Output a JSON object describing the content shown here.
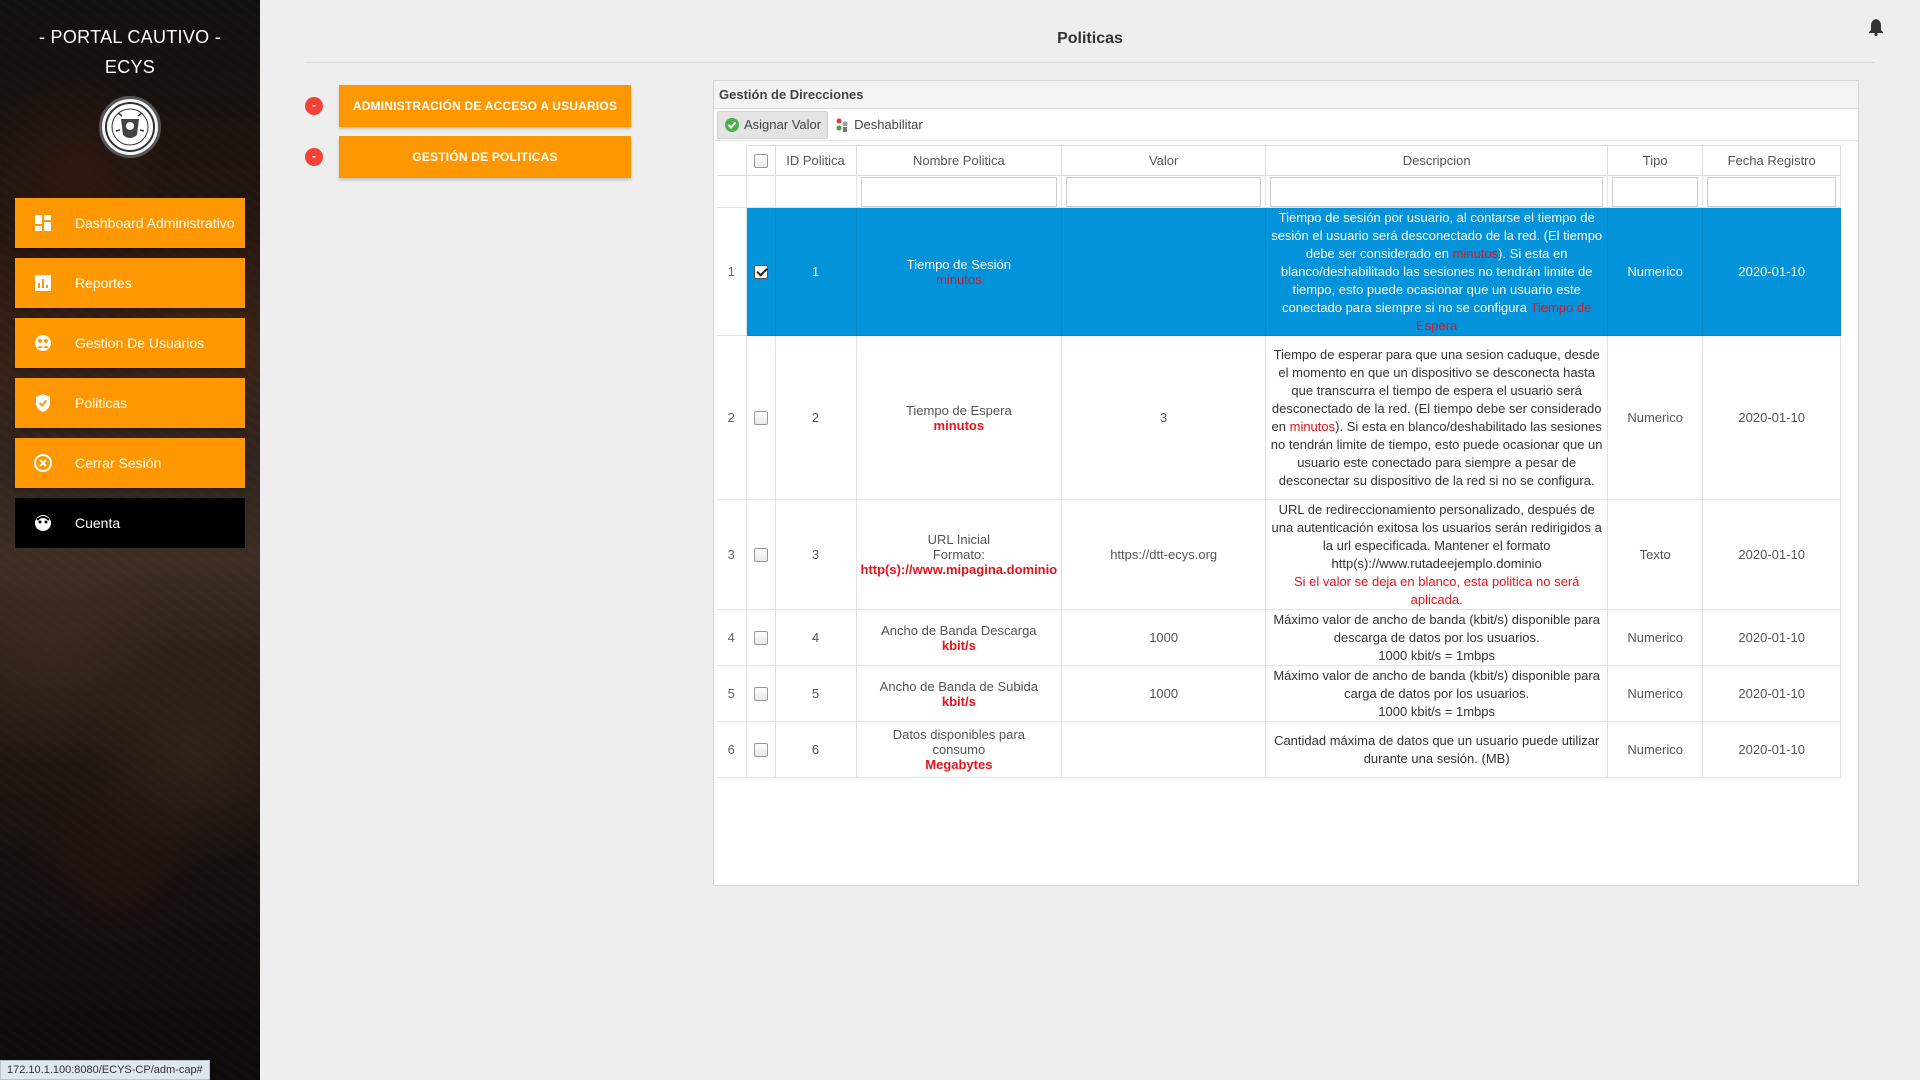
{
  "brand": {
    "line1": "- PORTAL CAUTIVO -",
    "line2": "ECYS"
  },
  "sidebar": {
    "items": [
      {
        "label": "Dashboard Administrativo",
        "icon": "dashboard-icon"
      },
      {
        "label": "Reportes",
        "icon": "bar-chart-icon"
      },
      {
        "label": "Gestion De Usuarios",
        "icon": "users-icon"
      },
      {
        "label": "Politicas",
        "icon": "shield-check-icon"
      },
      {
        "label": "Cerrar Sesión",
        "icon": "close-circle-icon"
      },
      {
        "label": "Cuenta",
        "icon": "account-icon"
      }
    ]
  },
  "header": {
    "title": "Politicas"
  },
  "actions": [
    {
      "dot": "-",
      "label": "Administración de acceso a usuarios"
    },
    {
      "dot": "-",
      "label": "Gestión de Politicas"
    }
  ],
  "panel": {
    "title": "Gestión de Direcciones",
    "toolbar": {
      "assign": "Asignar Valor",
      "disable": "Deshabilitar"
    },
    "columns": [
      "ID Politica",
      "Nombre Politica",
      "Valor",
      "Descripcion",
      "Tipo",
      "Fecha Registro"
    ],
    "rows": [
      {
        "num": "1",
        "checked": true,
        "selected": true,
        "id": "1",
        "name": "Tiempo de Sesión",
        "name2": "",
        "unit": "minutos",
        "valor": "",
        "desc_a": "Tiempo de sesión por usuario, al contarse el tiempo de sesión el usuario será desconectado de la red. (El tiempo debe ser considerado en ",
        "desc_red1": "minutos",
        "desc_b": "). Si esta en blanco/deshabilitado las sesiones no tendrán limite de tiempo, esto puede ocasionar que un usuario este conectado para siempre si no se configura ",
        "desc_red2": "Tiempo de Espera",
        "desc_c": "",
        "tipo": "Numerico",
        "fecha": "2020-01-10"
      },
      {
        "num": "2",
        "checked": false,
        "selected": false,
        "id": "2",
        "name": "Tiempo de Espera",
        "name2": "",
        "unit": "minutos",
        "valor": "3",
        "desc_a": "Tiempo de esperar para que una sesion caduque, desde el momento en que un dispositivo se desconecta hasta que transcurra el tiempo de espera el usuario será desconectado de la red. (El tiempo debe ser considerado en ",
        "desc_red1": "minutos",
        "desc_b": "). Si esta en blanco/deshabilitado las sesiones no tendrán limite de tiempo, esto puede ocasionar que un usuario este conectado para siempre a pesar de desconectar su dispositivo de la red si no se configura.",
        "desc_red2": "",
        "desc_c": "",
        "tipo": "Numerico",
        "fecha": "2020-01-10"
      },
      {
        "num": "3",
        "checked": false,
        "selected": false,
        "id": "3",
        "name": "URL Inicial",
        "name2": "Formato:",
        "unit": "http(s)://www.mipagina.dominio",
        "valor": "https://dtt-ecys.org",
        "desc_a": "URL de redireccionamiento personalizado, después de una autenticación exitosa los usuarios serán redirigidos a la url especificada. Mantener el formato http(s)://www.rutadeejemplo.dominio",
        "desc_red1": "",
        "desc_b": "",
        "desc_red2": "",
        "desc_c": "Si el valor se deja en blanco, esta politica no será aplicada.",
        "tipo": "Texto",
        "fecha": "2020-01-10"
      },
      {
        "num": "4",
        "checked": false,
        "selected": false,
        "id": "4",
        "name": "Ancho de Banda Descarga",
        "name2": "",
        "unit": "kbit/s",
        "valor": "1000",
        "desc_a": "Máximo valor de ancho de banda (kbit/s) disponible para descarga de datos por los usuarios.",
        "desc_red1": "",
        "desc_b": "1000 kbit/s = 1mbps",
        "desc_red2": "",
        "desc_c": "",
        "tipo": "Numerico",
        "fecha": "2020-01-10"
      },
      {
        "num": "5",
        "checked": false,
        "selected": false,
        "id": "5",
        "name": "Ancho de Banda de Subida",
        "name2": "",
        "unit": "kbit/s",
        "valor": "1000",
        "desc_a": "Máximo valor de ancho de banda (kbit/s) disponible para carga de datos por los usuarios.",
        "desc_red1": "",
        "desc_b": "1000 kbit/s = 1mbps",
        "desc_red2": "",
        "desc_c": "",
        "tipo": "Numerico",
        "fecha": "2020-01-10"
      },
      {
        "num": "6",
        "checked": false,
        "selected": false,
        "id": "6",
        "name": "Datos disponibles para consumo",
        "name2": "",
        "unit": "Megabytes",
        "valor": "",
        "desc_a": "Cantidad máxima de datos que un usuario puede utilizar durante una sesión. (MB)",
        "desc_red1": "",
        "desc_b": "",
        "desc_red2": "",
        "desc_c": "",
        "tipo": "Numerico",
        "fecha": "2020-01-10"
      }
    ]
  },
  "status_url": "172.10.1.100:8080/ECYS-CP/adm-cap#"
}
